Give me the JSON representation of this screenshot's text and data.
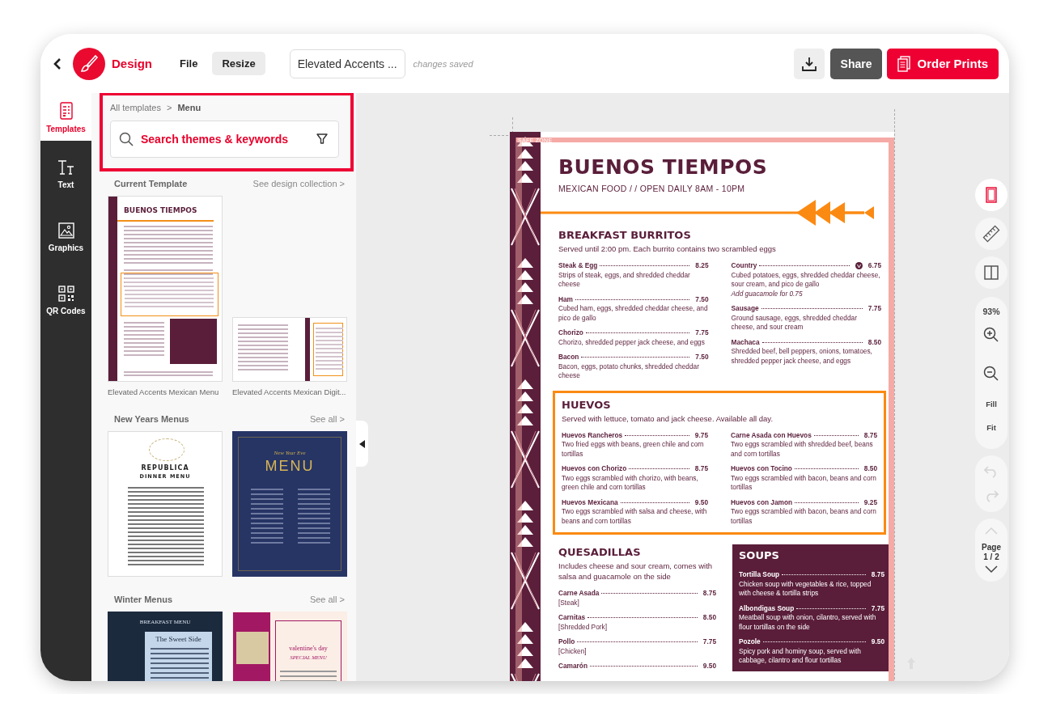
{
  "topbar": {
    "app_name": "Design",
    "menu": [
      {
        "label": "File",
        "kind": "text"
      },
      {
        "label": "Resize",
        "kind": "filled"
      }
    ],
    "document_name": "Elevated Accents ...",
    "save_status": "changes saved",
    "share_button": "Share",
    "order_button": "Order Prints"
  },
  "rail": [
    {
      "label": "Templates",
      "kind": "templates",
      "selected": true
    },
    {
      "label": "Text",
      "kind": "text",
      "selected": false
    },
    {
      "label": "Graphics",
      "kind": "graphics",
      "selected": false
    },
    {
      "label": "QR Codes",
      "kind": "qr",
      "selected": false
    }
  ],
  "panel": {
    "breadcrumb": {
      "parent": "All templates",
      "separator": ">",
      "current": "Menu"
    },
    "search": {
      "placeholder": "Search themes & keywords"
    },
    "sections": [
      {
        "title": "Current Template",
        "link": "See design collection >",
        "templates": [
          {
            "kind": "burritos",
            "caption": "Elevated Accents Mexican Menu",
            "texts": [
              "BUENOS TIEMPOS"
            ]
          },
          {
            "kind": "digital",
            "caption": "Elevated Accents Mexican Digit..."
          }
        ]
      },
      {
        "title": "New Years Menus",
        "link": "See all >",
        "templates": [
          {
            "kind": "republica",
            "texts": [
              "REPUBLICA",
              "DINNER MENU"
            ]
          },
          {
            "kind": "navy",
            "texts": [
              "New Year Eve",
              "MENU"
            ]
          }
        ]
      },
      {
        "title": "Winter Menus",
        "link": "See all >",
        "templates": [
          {
            "kind": "winter",
            "texts": [
              "BREAKFAST MENU",
              "The Sweet Side"
            ]
          },
          {
            "kind": "valentine",
            "texts": [
              "valentine's day",
              "SPECIAL MENU"
            ]
          }
        ]
      }
    ]
  },
  "canvas": {
    "safe_zone_label": "SAFE ZONE",
    "document": {
      "title": "BUENOS TIEMPOS",
      "subtitle": "MEXICAN FOOD / / OPEN DAILY 8AM - 10PM",
      "rows": [
        [
          {
            "kind": "plain",
            "title": "BREAKFAST BURRITOS",
            "description": "Served until 2:00 pm. Each burrito contains two scrambled eggs",
            "columns": [
              [
                {
                  "name": "Steak & Egg",
                  "price": "8.25",
                  "description": "Strips of steak, eggs, and shredded cheddar cheese",
                  "badge": false
                },
                {
                  "name": "Ham",
                  "price": "7.50",
                  "description": "Cubed ham, eggs, shredded cheddar cheese, and pico de gallo",
                  "badge": false
                },
                {
                  "name": "Chorizo",
                  "price": "7.75",
                  "description": "Chorizo, shredded pepper jack cheese, and eggs",
                  "badge": false
                },
                {
                  "name": "Bacon",
                  "price": "7.50",
                  "description": "Bacon, eggs, potato chunks, shredded cheddar cheese",
                  "badge": false
                }
              ],
              [
                {
                  "name": "Country",
                  "price": "6.75",
                  "description": "Cubed potatoes, eggs, shredded cheddar cheese, sour cream, and pico de gallo",
                  "note": "Add guacamole for 0.75",
                  "badge": true
                },
                {
                  "name": "Sausage",
                  "price": "7.75",
                  "description": "Ground sausage, eggs, shredded cheddar cheese, and sour cream",
                  "badge": false
                },
                {
                  "name": "Machaca",
                  "price": "8.50",
                  "description": "Shredded beef, bell peppers, onions, tomatoes, shredded pepper jack cheese, and eggs",
                  "badge": false
                }
              ]
            ]
          }
        ],
        [
          {
            "kind": "boxed",
            "title": "HUEVOS",
            "description": "Served with lettuce, tomato and jack cheese. Available all day.",
            "columns": [
              [
                {
                  "name": "Huevos Rancheros",
                  "price": "9.75",
                  "description": "Two fried eggs with beans, green chile and corn tortillas"
                },
                {
                  "name": "Huevos con Chorizo",
                  "price": "8.75",
                  "description": "Two eggs scrambled with chorizo, with beans, green chile and corn tortillas"
                },
                {
                  "name": "Huevos Mexicana",
                  "price": "9.50",
                  "description": "Two eggs scrambled with salsa and cheese, with beans and corn tortillas"
                }
              ],
              [
                {
                  "name": "Carne Asada con Huevos",
                  "price": "8.75",
                  "description": "Two eggs scrambled with shredded beef, beans and corn tortillas"
                },
                {
                  "name": "Huevos con Tocino",
                  "price": "8.50",
                  "description": "Two eggs scrambled with bacon, beans and corn tortillas"
                },
                {
                  "name": "Huevos con Jamon",
                  "price": "9.25",
                  "description": "Two eggs scrambled with bacon, beans and corn tortillas"
                }
              ]
            ]
          }
        ],
        [
          {
            "kind": "plain",
            "title": "QUESADILLAS",
            "description": "Includes cheese and sour cream, comes with salsa and guacamole on the side",
            "columns": [
              [
                {
                  "name": "Carne Asada",
                  "price": "8.75",
                  "description": "[Steak]"
                },
                {
                  "name": "Carnitas",
                  "price": "8.50",
                  "description": "[Shredded Pork]"
                },
                {
                  "name": "Pollo",
                  "price": "7.75",
                  "description": "[Chicken]"
                },
                {
                  "name": "Camarón",
                  "price": "9.50"
                }
              ]
            ]
          },
          {
            "kind": "dark",
            "title": "SOUPS",
            "columns": [
              [
                {
                  "name": "Tortilla Soup",
                  "price": "8.75",
                  "description": "Chicken soup with vegetables & rice, topped with cheese & tortilla strips"
                },
                {
                  "name": "Albondigas Soup",
                  "price": "7.75",
                  "description": "Meatball soup with onion, cilantro, served with flour tortillas on the side"
                },
                {
                  "name": "Pozole",
                  "price": "9.50",
                  "description": "Spicy pork and hominy soup, served with cabbage, cilantro and flour tortillas"
                }
              ]
            ]
          }
        ]
      ]
    }
  },
  "tools": {
    "view_buttons": [
      {
        "kind": "page",
        "selected": true
      },
      {
        "kind": "ruler",
        "selected": false
      },
      {
        "kind": "columns",
        "selected": false
      }
    ],
    "zoom": {
      "level_text": "93%",
      "fill": "Fill",
      "fit": "Fit"
    },
    "history": {
      "undo_disabled": true,
      "redo_disabled": true
    },
    "pager": {
      "label": "Page",
      "value": "1 / 2",
      "previous_disabled": true,
      "next_disabled": false
    }
  }
}
